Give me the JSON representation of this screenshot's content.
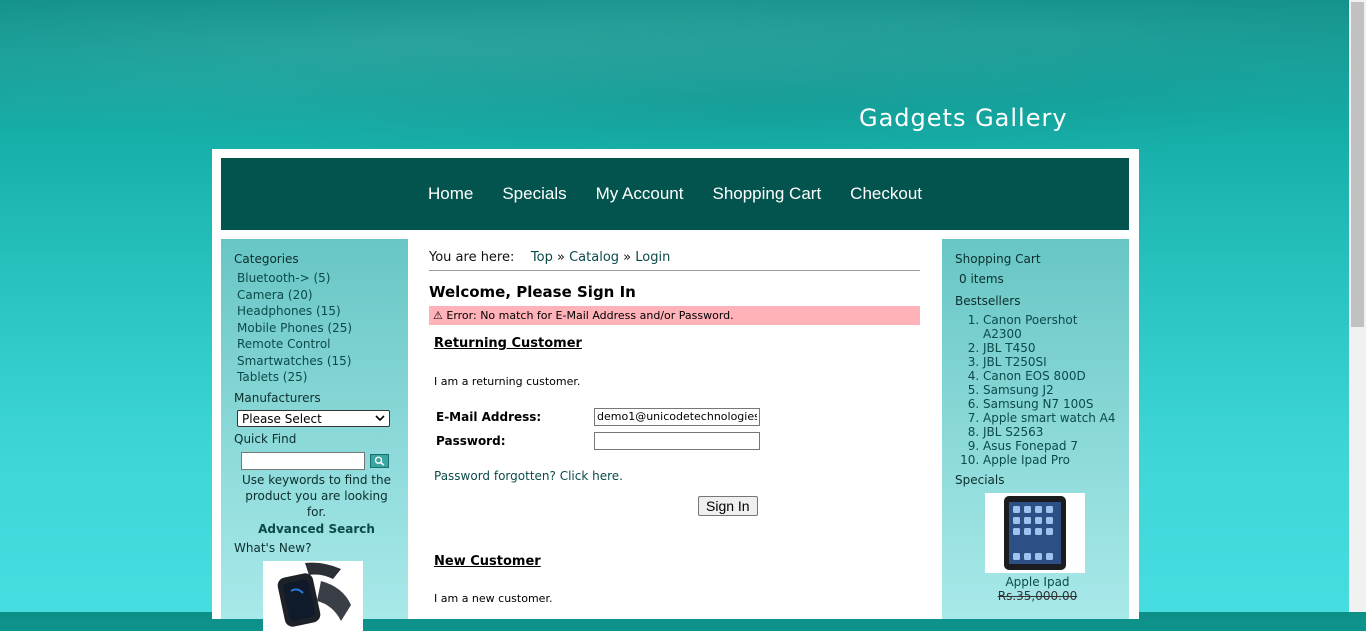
{
  "site": {
    "title": "Gadgets Gallery"
  },
  "nav": [
    "Home",
    "Specials",
    "My Account",
    "Shopping Cart",
    "Checkout"
  ],
  "left": {
    "categories_heading": "Categories",
    "categories": [
      "Bluetooth-> (5)",
      "Camera (20)",
      "Headphones (15)",
      "Mobile Phones (25)",
      "Remote Control",
      "Smartwatches (15)",
      "Tablets (25)"
    ],
    "manufacturers_heading": "Manufacturers",
    "manufacturers_selected": "Please Select",
    "quickfind_heading": "Quick Find",
    "quickfind_hint": "Use keywords to find the product you are looking for.",
    "advanced_search": "Advanced Search",
    "whats_new_heading": "What's New?"
  },
  "breadcrumb": {
    "prefix": "You are here:",
    "items": [
      "Top",
      "Catalog",
      "Login"
    ],
    "separator": "»"
  },
  "main": {
    "title": "Welcome, Please Sign In",
    "error": "Error: No match for E-Mail Address and/or Password.",
    "returning_title": "Returning Customer",
    "returning_text": "I am a returning customer.",
    "email_label": "E-Mail Address:",
    "email_value": "demo1@unicodetechnologies",
    "password_label": "Password:",
    "password_value": "",
    "forgot_link": "Password forgotten? Click here.",
    "signin_button": "Sign In",
    "new_title": "New Customer",
    "new_text": "I am a new customer."
  },
  "right": {
    "cart_heading": "Shopping Cart",
    "cart_items": "0 items",
    "bestsellers_heading": "Bestsellers",
    "bestsellers": [
      "Canon Poershot A2300",
      "JBL T450",
      "JBL T250SI",
      "Canon EOS 800D",
      "Samsung J2",
      "Samsung N7 100S",
      "Apple smart watch A4",
      "JBL S2563",
      "Asus Fonepad 7",
      "Apple Ipad Pro"
    ],
    "specials_heading": "Specials",
    "special_product": "Apple Ipad",
    "special_old_price": "Rs.35,000.00"
  }
}
